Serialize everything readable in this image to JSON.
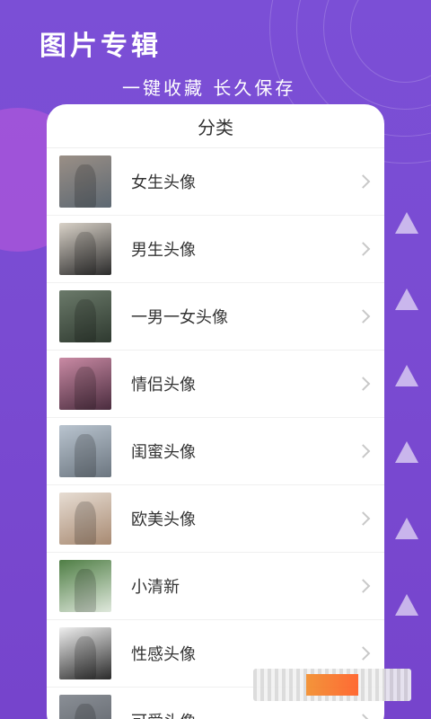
{
  "promo": {
    "title": "图片专辑",
    "subtitle": "一键收藏  长久保存"
  },
  "card": {
    "header": "分类",
    "items": [
      {
        "label": "女生头像",
        "thumb_color": "#9a8f86",
        "thumb_color2": "#5d6872"
      },
      {
        "label": "男生头像",
        "thumb_color": "#d9d2c8",
        "thumb_color2": "#2b2b2b"
      },
      {
        "label": "一男一女头像",
        "thumb_color": "#6b7a6a",
        "thumb_color2": "#2f3a30"
      },
      {
        "label": "情侣头像",
        "thumb_color": "#c98aa4",
        "thumb_color2": "#4a2c3e"
      },
      {
        "label": "闺蜜头像",
        "thumb_color": "#b9c4cf",
        "thumb_color2": "#6c7680"
      },
      {
        "label": "欧美头像",
        "thumb_color": "#e7ddd3",
        "thumb_color2": "#a88a72"
      },
      {
        "label": "小清新",
        "thumb_color": "#4f7e45",
        "thumb_color2": "#dfe8dc"
      },
      {
        "label": "性感头像",
        "thumb_color": "#efefef",
        "thumb_color2": "#2a2a2a"
      },
      {
        "label": "可爱头像",
        "thumb_color": "#8a8f96",
        "thumb_color2": "#5b5f66"
      }
    ]
  },
  "colors": {
    "background": "#7a4bd2",
    "card": "#ffffff",
    "text": "#333333"
  }
}
